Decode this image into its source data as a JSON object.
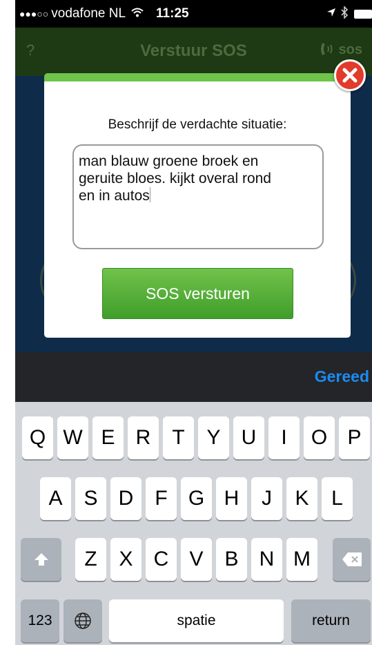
{
  "status_bar": {
    "signal": "●●●○○",
    "carrier": "vodafone NL",
    "time": "11:25"
  },
  "nav": {
    "help_label": "?",
    "title": "Verstuur SOS",
    "sos_label": "sos"
  },
  "modal": {
    "prompt": "Beschrijf de verdachte situatie:",
    "description_value": "man blauw groene broek en\ngeruite bloes. kijkt overal rond\nen in autos",
    "send_label": "SOS versturen"
  },
  "accessory": {
    "done_label": "Gereed"
  },
  "keyboard": {
    "row1": [
      "Q",
      "W",
      "E",
      "R",
      "T",
      "Y",
      "U",
      "I",
      "O",
      "P"
    ],
    "row2": [
      "A",
      "S",
      "D",
      "F",
      "G",
      "H",
      "J",
      "K",
      "L"
    ],
    "row3": [
      "Z",
      "X",
      "C",
      "V",
      "B",
      "N",
      "M"
    ],
    "numbers_label": "123",
    "space_label": "spatie",
    "return_label": "return"
  },
  "colors": {
    "accent_green": "#6fc44a",
    "done_blue": "#1b8cf2",
    "close_red": "#e23b2b"
  },
  "icons": {
    "wifi": "wifi-icon",
    "location": "location-arrow-icon",
    "bluetooth": "bluetooth-icon",
    "battery": "battery-icon",
    "speaker": "speaker-icon",
    "close": "close-icon",
    "shift": "shift-icon",
    "backspace": "backspace-icon",
    "globe": "globe-icon"
  }
}
